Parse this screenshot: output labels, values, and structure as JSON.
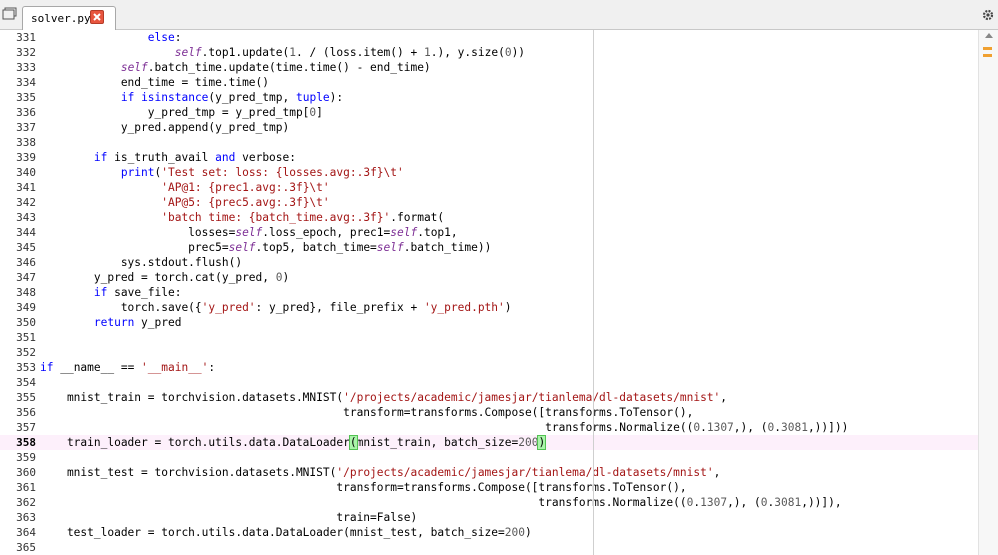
{
  "tab": {
    "title": "solver.py"
  },
  "current_line": "358",
  "colors": {
    "keyword": "#0000ff",
    "string": "#a31515",
    "self": "#7d2f95",
    "current_line_bg": "#fdf0fb",
    "bracket_match": "#a9f5a9"
  },
  "icons": {
    "tab_menu": "tab-menu-icon",
    "tab_close": "close-icon",
    "settings": "gear-icon",
    "scroll_up": "arrow-up-icon"
  },
  "lines": [
    {
      "n": "331",
      "t": "                else:"
    },
    {
      "n": "332",
      "t": "                    self.top1.update(1. / (loss.item() + 1.), y.size(0))"
    },
    {
      "n": "333",
      "t": "            self.batch_time.update(time.time() - end_time)"
    },
    {
      "n": "334",
      "t": "            end_time = time.time()"
    },
    {
      "n": "335",
      "t": "            if isinstance(y_pred_tmp, tuple):"
    },
    {
      "n": "336",
      "t": "                y_pred_tmp = y_pred_tmp[0]"
    },
    {
      "n": "337",
      "t": "            y_pred.append(y_pred_tmp)"
    },
    {
      "n": "338",
      "t": ""
    },
    {
      "n": "339",
      "t": "        if is_truth_avail and verbose:"
    },
    {
      "n": "340",
      "t": "            print('Test set: loss: {losses.avg:.3f}\\t'"
    },
    {
      "n": "341",
      "t": "                  'AP@1: {prec1.avg:.3f}\\t'"
    },
    {
      "n": "342",
      "t": "                  'AP@5: {prec5.avg:.3f}\\t'"
    },
    {
      "n": "343",
      "t": "                  'batch time: {batch_time.avg:.3f}'.format("
    },
    {
      "n": "344",
      "t": "                      losses=self.loss_epoch, prec1=self.top1,"
    },
    {
      "n": "345",
      "t": "                      prec5=self.top5, batch_time=self.batch_time))"
    },
    {
      "n": "346",
      "t": "            sys.stdout.flush()"
    },
    {
      "n": "347",
      "t": "        y_pred = torch.cat(y_pred, 0)"
    },
    {
      "n": "348",
      "t": "        if save_file:"
    },
    {
      "n": "349",
      "t": "            torch.save({'y_pred': y_pred}, file_prefix + 'y_pred.pth')"
    },
    {
      "n": "350",
      "t": "        return y_pred"
    },
    {
      "n": "351",
      "t": ""
    },
    {
      "n": "352",
      "t": ""
    },
    {
      "n": "353",
      "t": "if __name__ == '__main__':"
    },
    {
      "n": "354",
      "t": ""
    },
    {
      "n": "355",
      "t": "    mnist_train = torchvision.datasets.MNIST('/projects/academic/jamesjar/tianlema/dl-datasets/mnist',"
    },
    {
      "n": "356",
      "t": "                                             transform=transforms.Compose([transforms.ToTensor(),"
    },
    {
      "n": "357",
      "t": "                                                                           transforms.Normalize((0.1307,), (0.3081,))]))"
    },
    {
      "n": "358",
      "t": "    train_loader = torch.utils.data.DataLoader(mnist_train, batch_size=200)"
    },
    {
      "n": "359",
      "t": ""
    },
    {
      "n": "360",
      "t": "    mnist_test = torchvision.datasets.MNIST('/projects/academic/jamesjar/tianlema/dl-datasets/mnist',"
    },
    {
      "n": "361",
      "t": "                                            transform=transforms.Compose([transforms.ToTensor(),"
    },
    {
      "n": "362",
      "t": "                                                                          transforms.Normalize((0.1307,), (0.3081,))]),"
    },
    {
      "n": "363",
      "t": "                                            train=False)"
    },
    {
      "n": "364",
      "t": "    test_loader = torch.utils.data.DataLoader(mnist_test, batch_size=200)"
    },
    {
      "n": "365",
      "t": ""
    }
  ]
}
